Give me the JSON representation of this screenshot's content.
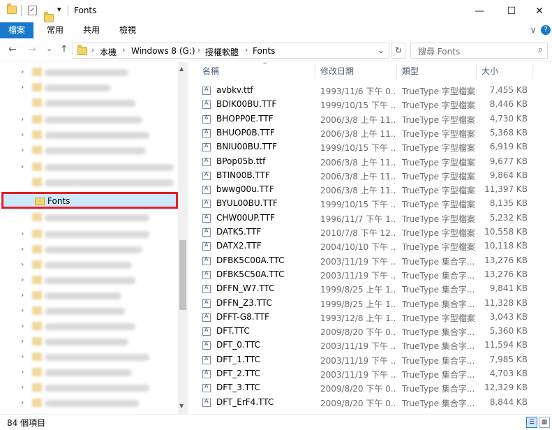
{
  "window": {
    "title": "Fonts",
    "minimize": "—",
    "maximize": "☐",
    "close": "✕"
  },
  "quick_access": {
    "dropdown": "▾"
  },
  "ribbon": {
    "tabs": [
      "檔案",
      "常用",
      "共用",
      "檢視"
    ],
    "expand": "∨",
    "help": "?"
  },
  "address": {
    "back": "←",
    "forward": "→",
    "recent": "⌄",
    "up": "↑",
    "crumbs": [
      "本機",
      "Windows 8 (G:)",
      "授權軟體",
      "Fonts"
    ],
    "separator": "›",
    "dropdown": "⌄",
    "refresh": "↻"
  },
  "search": {
    "placeholder": "搜尋 Fonts",
    "icon": "⌕"
  },
  "nav": {
    "selected_label": "Fonts",
    "chevron": "›",
    "scroll_up": "▲",
    "scroll_down": "▼"
  },
  "columns": {
    "name": "名稱",
    "date": "修改日期",
    "type": "類型",
    "size": "大小",
    "sort_arrow": "^"
  },
  "files": [
    {
      "name": "avbkv.ttf",
      "date": "1993/11/6 下午 0...",
      "type": "TrueType 字型檔案",
      "size": "7,455 KB"
    },
    {
      "name": "BDIK00BU.TTF",
      "date": "1999/10/15 下午 ...",
      "type": "TrueType 字型檔案",
      "size": "8,446 KB"
    },
    {
      "name": "BHOPP0E.TTF",
      "date": "2006/3/8 上午 11...",
      "type": "TrueType 字型檔案",
      "size": "4,730 KB"
    },
    {
      "name": "BHUOP0B.TTF",
      "date": "2006/3/8 上午 11...",
      "type": "TrueType 字型檔案",
      "size": "5,368 KB"
    },
    {
      "name": "BNIU00BU.TTF",
      "date": "1999/10/15 下午 ...",
      "type": "TrueType 字型檔案",
      "size": "6,919 KB"
    },
    {
      "name": "BPop05b.ttf",
      "date": "2006/3/8 上午 11...",
      "type": "TrueType 字型檔案",
      "size": "9,677 KB"
    },
    {
      "name": "BTIN00B.TTF",
      "date": "2006/3/8 上午 11...",
      "type": "TrueType 字型檔案",
      "size": "9,864 KB"
    },
    {
      "name": "bwwg00u.TTF",
      "date": "2006/3/8 上午 11...",
      "type": "TrueType 字型檔案",
      "size": "11,397 KB"
    },
    {
      "name": "BYUL00BU.TTF",
      "date": "1999/10/15 下午 ...",
      "type": "TrueType 字型檔案",
      "size": "8,135 KB"
    },
    {
      "name": "CHW00UP.TTF",
      "date": "1996/11/7 下午 1...",
      "type": "TrueType 字型檔案",
      "size": "5,232 KB"
    },
    {
      "name": "DATK5.TTF",
      "date": "2010/7/8 下午 12...",
      "type": "TrueType 字型檔案",
      "size": "10,558 KB"
    },
    {
      "name": "DATX2.TTF",
      "date": "2004/10/10 下午 ...",
      "type": "TrueType 字型檔案",
      "size": "10,118 KB"
    },
    {
      "name": "DFBK5C00A.TTC",
      "date": "2003/11/19 下午 ...",
      "type": "TrueType 集合字...",
      "size": "13,276 KB"
    },
    {
      "name": "DFBK5C50A.TTC",
      "date": "2003/11/19 下午 ...",
      "type": "TrueType 集合字...",
      "size": "13,276 KB"
    },
    {
      "name": "DFFN_W7.TTC",
      "date": "1999/8/25 上午 1...",
      "type": "TrueType 集合字...",
      "size": "9,841 KB"
    },
    {
      "name": "DFFN_Z3.TTC",
      "date": "1999/8/25 上午 1...",
      "type": "TrueType 集合字...",
      "size": "11,328 KB"
    },
    {
      "name": "DFFT-G8.TTF",
      "date": "1993/12/8 上午 1...",
      "type": "TrueType 字型檔案",
      "size": "3,043 KB"
    },
    {
      "name": "DFT.TTC",
      "date": "2009/8/20 下午 0...",
      "type": "TrueType 集合字...",
      "size": "5,360 KB"
    },
    {
      "name": "DFT_0.TTC",
      "date": "2003/11/19 下午 ...",
      "type": "TrueType 集合字...",
      "size": "11,594 KB"
    },
    {
      "name": "DFT_1.TTC",
      "date": "2003/11/19 下午 ...",
      "type": "TrueType 集合字...",
      "size": "7,985 KB"
    },
    {
      "name": "DFT_2.TTC",
      "date": "2003/11/19 下午 ...",
      "type": "TrueType 集合字...",
      "size": "4,703 KB"
    },
    {
      "name": "DFT_3.TTC",
      "date": "2009/8/20 下午 0...",
      "type": "TrueType 集合字...",
      "size": "12,329 KB"
    },
    {
      "name": "DFT_ErF4.TTC",
      "date": "2009/8/20 下午 0...",
      "type": "TrueType 集合字...",
      "size": "8,844 KB"
    }
  ],
  "status": {
    "item_count": "84 個項目",
    "details_view": "☰",
    "icons_view": "▦"
  },
  "colors": {
    "accent": "#1979ca",
    "selection": "#cce8ff",
    "highlight_border": "#e21f26",
    "header_text": "#4c607a"
  }
}
